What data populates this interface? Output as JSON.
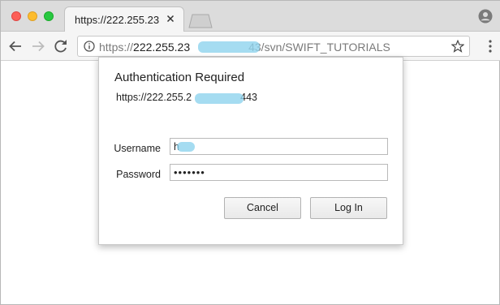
{
  "colors": {
    "tab_strip": "#dcdcdc",
    "toolbar": "#f5f5f5",
    "traffic_close": "#fc5f57",
    "traffic_minimize": "#fdbc2e",
    "traffic_zoom": "#28c840",
    "redaction": "#8fd3ee"
  },
  "tab": {
    "title": "https://222.255.23",
    "close_icon": "close-icon"
  },
  "omnibox": {
    "scheme": "https://",
    "host": "222.255.23",
    "path": "43/svn/SWIFT_TUTORIALS",
    "icon": "info-icon"
  },
  "dialog": {
    "title": "Authentication Required",
    "origin_prefix": "https://222.255.2",
    "origin_suffix": "443",
    "username_label": "Username",
    "password_label": "Password",
    "username_value": "h",
    "password_value": "•••••••",
    "cancel_label": "Cancel",
    "login_label": "Log In"
  }
}
